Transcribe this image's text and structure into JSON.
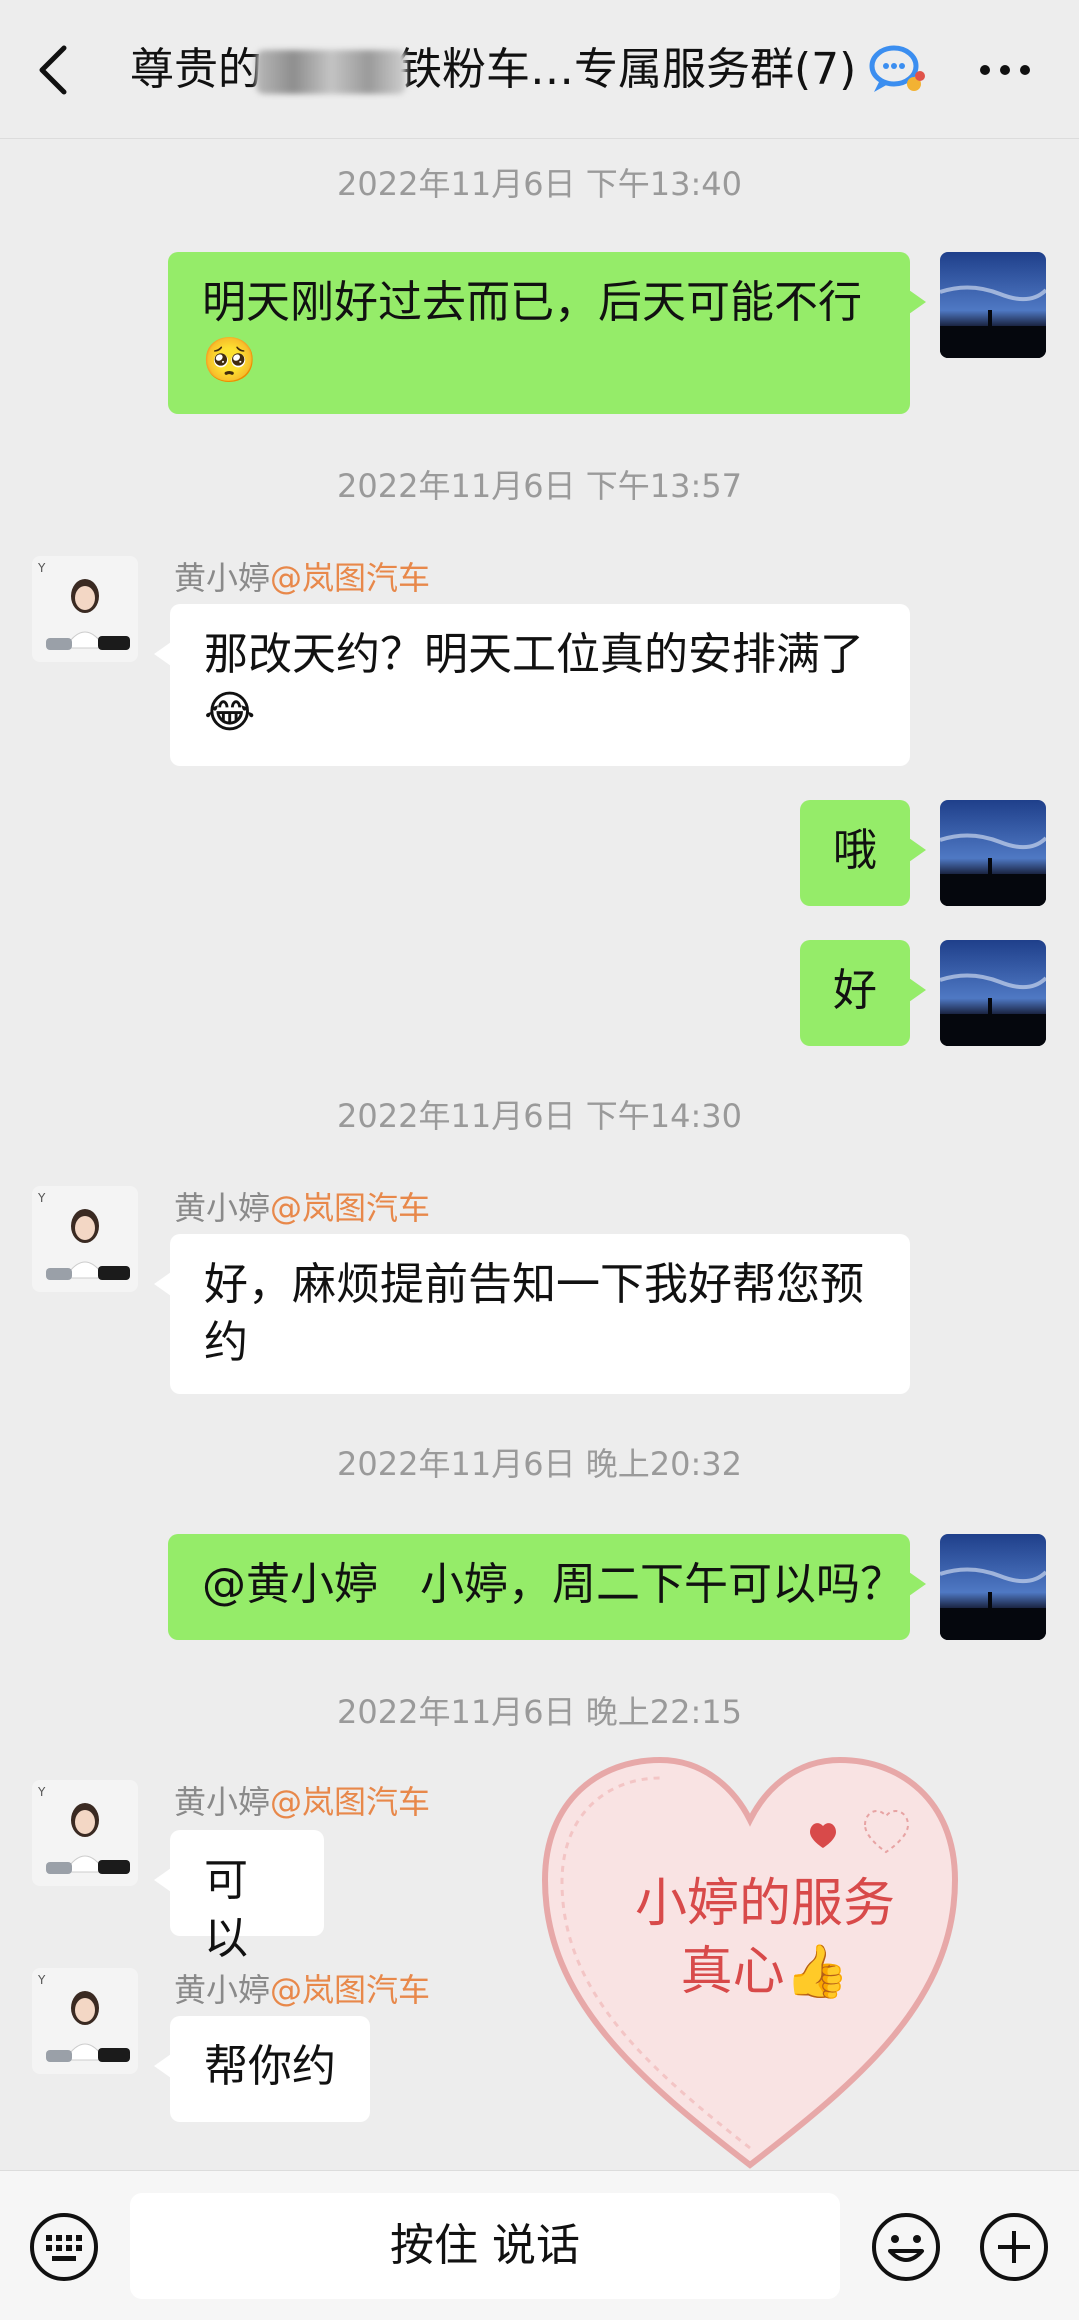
{
  "header": {
    "title_prefix": "尊贵的",
    "title_suffix": "铁粉车…专属服务群(7)"
  },
  "messages": {
    "ts1": "2022年11月6日 下午13:40",
    "m1_text": "明天刚好过去而已，后天可能不行",
    "m1_emoji": "🥺",
    "ts2": "2022年11月6日 下午13:57",
    "sender_name": "黄小婷",
    "sender_org": "@岚图汽车",
    "m2_text": "那改天约？明天工位真的安排满了",
    "m2_emoji": "😂",
    "m3_text": "哦",
    "m4_text": "好",
    "ts3": "2022年11月6日 下午14:30",
    "m5_text": "好，麻烦提前告知一下我好帮您预约",
    "ts4": "2022年11月6日 晚上20:32",
    "m6_text": "@黄小婷   小婷，周二下午可以吗？",
    "ts5": "2022年11月6日 晚上22:15",
    "m7_text": "可以",
    "m8_text": "帮你约"
  },
  "sticker": {
    "text": "小婷的服务真心👍"
  },
  "input": {
    "talk_label": "按住 说话"
  },
  "colors": {
    "my_bubble": "#95ec69",
    "other_bubble": "#ffffff",
    "background": "#ededed",
    "org_name": "#e8884a"
  },
  "icons": [
    "back-icon",
    "chat-icon",
    "more-icon",
    "keyboard-icon",
    "emoji-icon",
    "plus-icon"
  ]
}
